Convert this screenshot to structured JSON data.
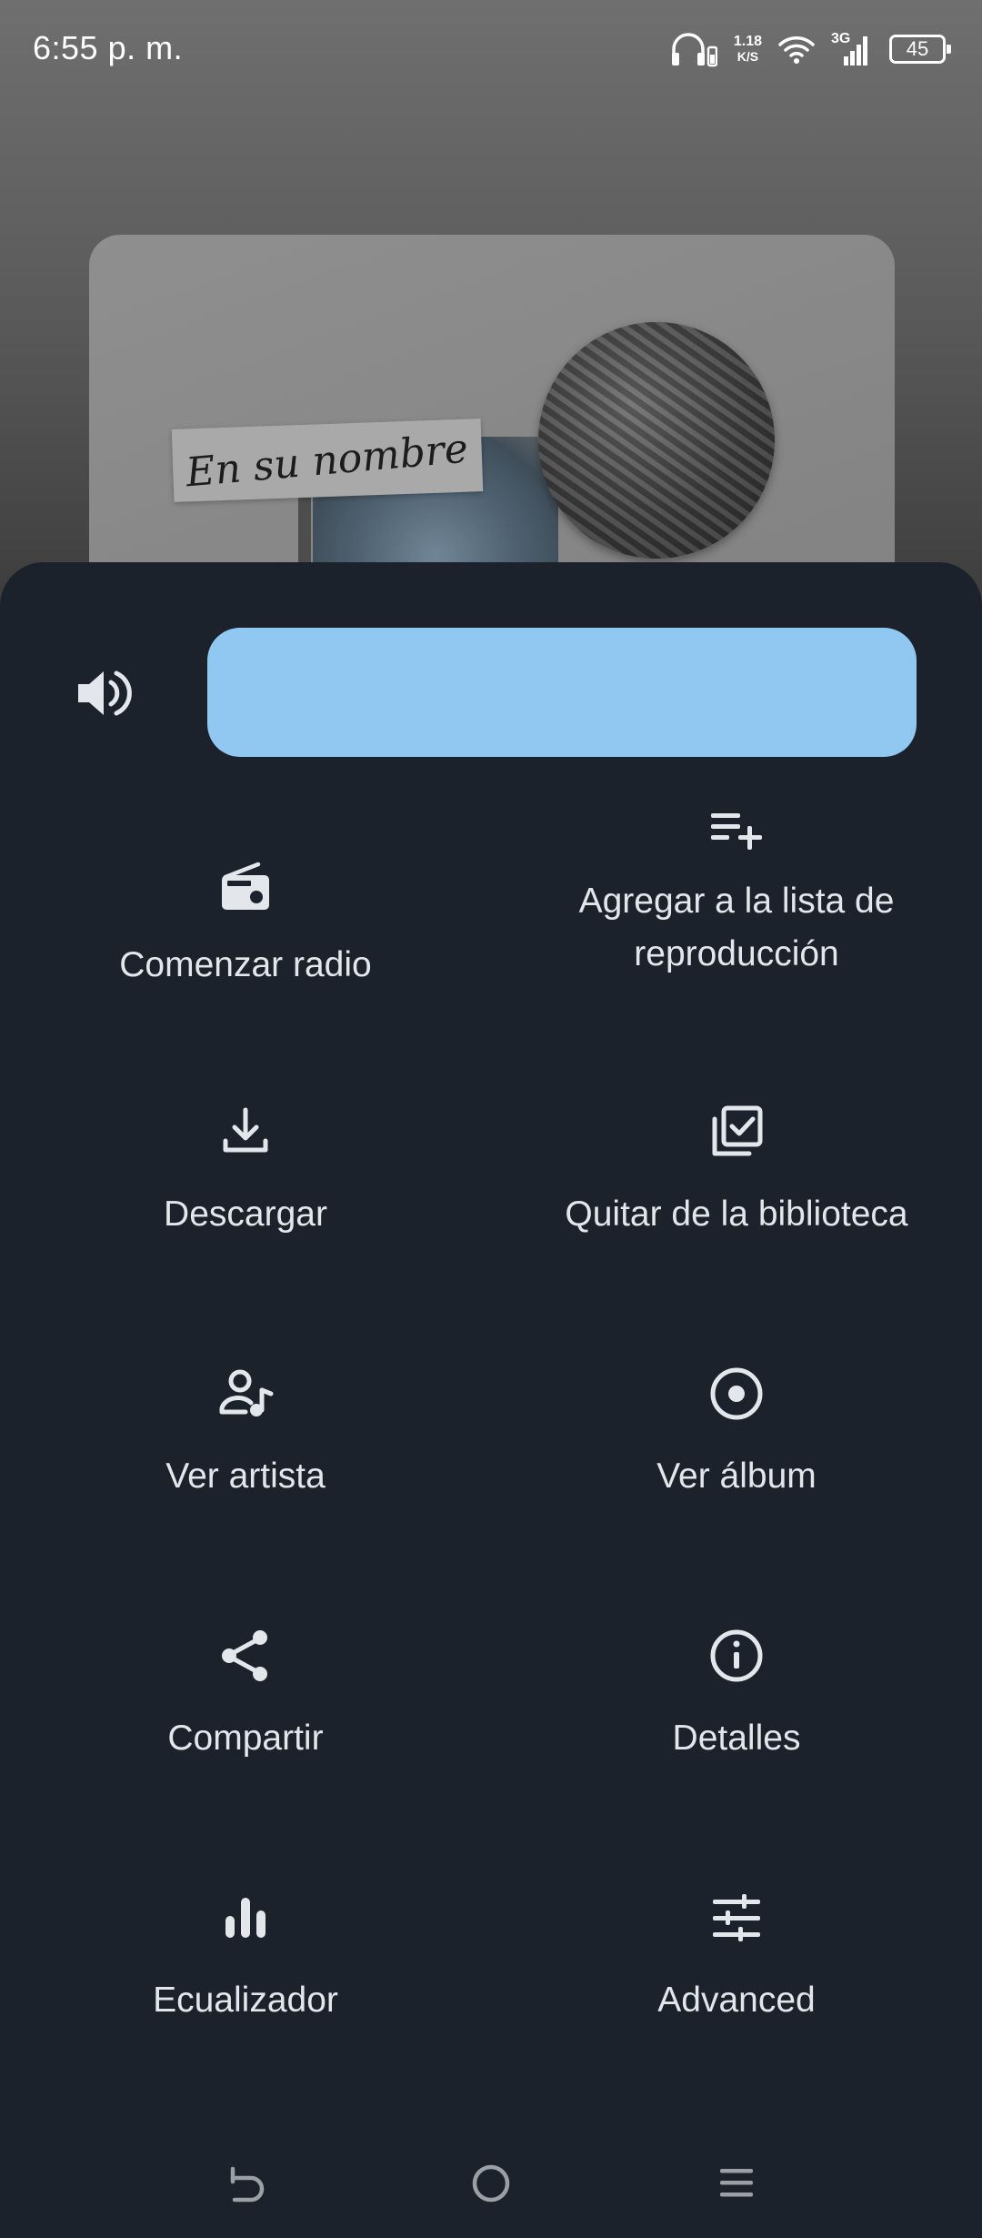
{
  "status_bar": {
    "time": "6:55 p. m.",
    "net_speed_value": "1.18",
    "net_speed_unit": "K/S",
    "network_type": "3G",
    "battery_level": "45"
  },
  "album_art": {
    "script_text": "En su nombre"
  },
  "volume": {
    "icon": "volume-up-icon",
    "slider_color": "#90c8f2"
  },
  "actions": [
    {
      "id": "start-radio",
      "label": "Comenzar radio",
      "icon": "radio-icon"
    },
    {
      "id": "add-to-playlist",
      "label": "Agregar a la lista de reproducción",
      "icon": "playlist-add-icon"
    },
    {
      "id": "download",
      "label": "Descargar",
      "icon": "download-icon"
    },
    {
      "id": "remove-from-library",
      "label": "Quitar de la biblioteca",
      "icon": "library-check-icon"
    },
    {
      "id": "view-artist",
      "label": "Ver artista",
      "icon": "artist-icon"
    },
    {
      "id": "view-album",
      "label": "Ver álbum",
      "icon": "album-icon"
    },
    {
      "id": "share",
      "label": "Compartir",
      "icon": "share-icon"
    },
    {
      "id": "details",
      "label": "Detalles",
      "icon": "info-icon"
    },
    {
      "id": "equalizer",
      "label": "Ecualizador",
      "icon": "equalizer-icon"
    },
    {
      "id": "advanced",
      "label": "Advanced",
      "icon": "tune-icon"
    }
  ],
  "nav": {
    "back_icon": "back-icon",
    "home_icon": "home-icon",
    "menu_icon": "menu-icon"
  },
  "colors": {
    "sheet_background": "#1b222c",
    "text": "#e3e6ea",
    "accent": "#90c8f2"
  }
}
